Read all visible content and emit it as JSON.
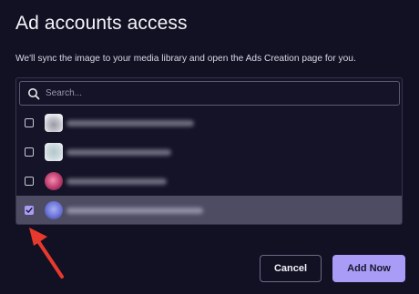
{
  "dialog": {
    "title": "Ad accounts access",
    "subtitle": "We'll sync the image to your media library and open the Ads Creation page for you."
  },
  "search": {
    "placeholder": "Search...",
    "value": ""
  },
  "accounts": [
    {
      "checked": false,
      "avatar_color": "#b9b9c4",
      "avatar": "gray-cloud-avatar"
    },
    {
      "checked": false,
      "avatar_color": "#c6d3d6",
      "avatar": "light-teal-avatar"
    },
    {
      "checked": false,
      "avatar_color": "#c9487a",
      "avatar": "pink-avatar"
    },
    {
      "checked": true,
      "avatar_color": "#6b74d6",
      "avatar": "blue-circle-avatar"
    }
  ],
  "buttons": {
    "cancel_label": "Cancel",
    "add_label": "Add Now"
  },
  "colors": {
    "background": "#121124",
    "accent": "#a99cf7",
    "selected_row": "#4d4c63",
    "arrow": "#e8392d"
  }
}
